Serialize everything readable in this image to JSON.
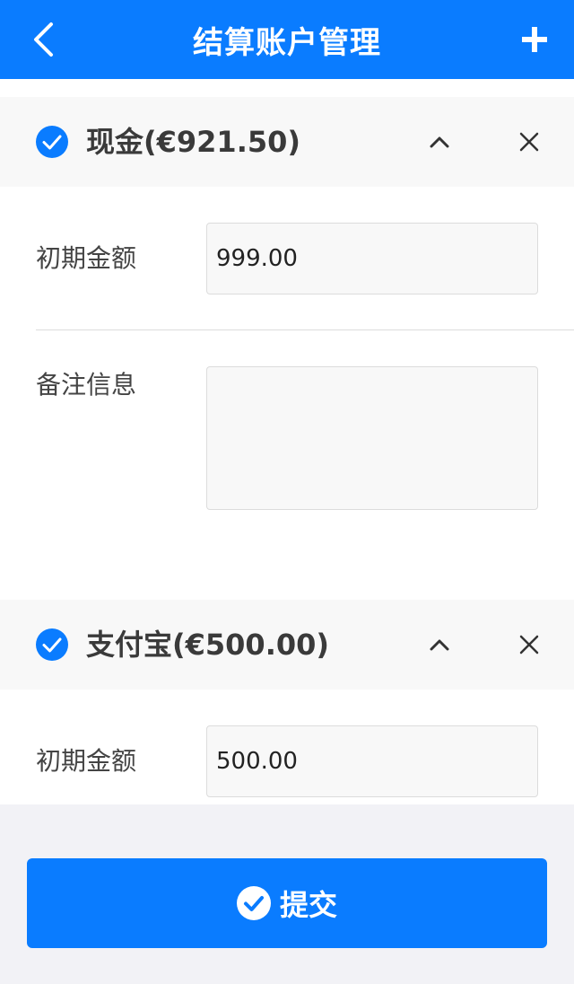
{
  "header": {
    "title": "结算账户管理",
    "back_icon": "chevron-left-icon",
    "add_icon": "plus-icon"
  },
  "accounts": [
    {
      "title": "现金(€921.50)",
      "checked": true,
      "expanded": true,
      "amount_label": "初期金额",
      "amount_value": "999.00",
      "note_label": "备注信息",
      "note_value": ""
    },
    {
      "title": "支付宝(€500.00)",
      "checked": true,
      "expanded": true,
      "amount_label": "初期金额",
      "amount_value": "500.00"
    }
  ],
  "footer": {
    "submit_label": "提交",
    "submit_icon": "check-circle-icon"
  },
  "colors": {
    "primary": "#0a7cff",
    "header_bg": "#f8f8f8",
    "page_bg": "#f2f2f6"
  }
}
